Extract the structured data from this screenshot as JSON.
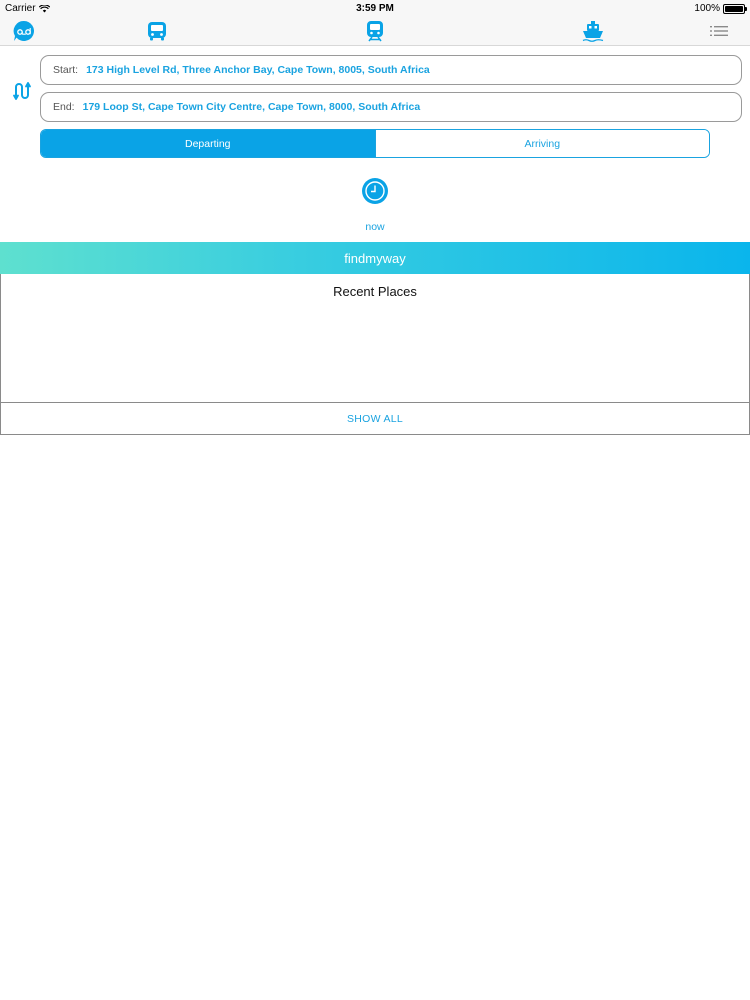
{
  "status_bar": {
    "carrier": "Carrier",
    "time": "3:59 PM",
    "battery": "100%"
  },
  "nav": {
    "icons": [
      "chat-ab-icon",
      "bus-icon",
      "train-icon",
      "ferry-icon",
      "list-menu-icon"
    ],
    "accent_color": "#0aa3e6"
  },
  "route": {
    "start_label": "Start:",
    "start_value": "173 High Level Rd, Three Anchor Bay, Cape Town, 8005, South Africa",
    "end_label": "End:",
    "end_value": "179 Loop St, Cape Town City Centre, Cape Town, 8000, South Africa"
  },
  "mode": {
    "options": [
      "Departing",
      "Arriving"
    ],
    "selected": "Departing"
  },
  "time_picker": {
    "value": "now"
  },
  "brand": {
    "name": "findmyway"
  },
  "recent": {
    "title": "Recent Places",
    "show_all": "SHOW ALL"
  }
}
